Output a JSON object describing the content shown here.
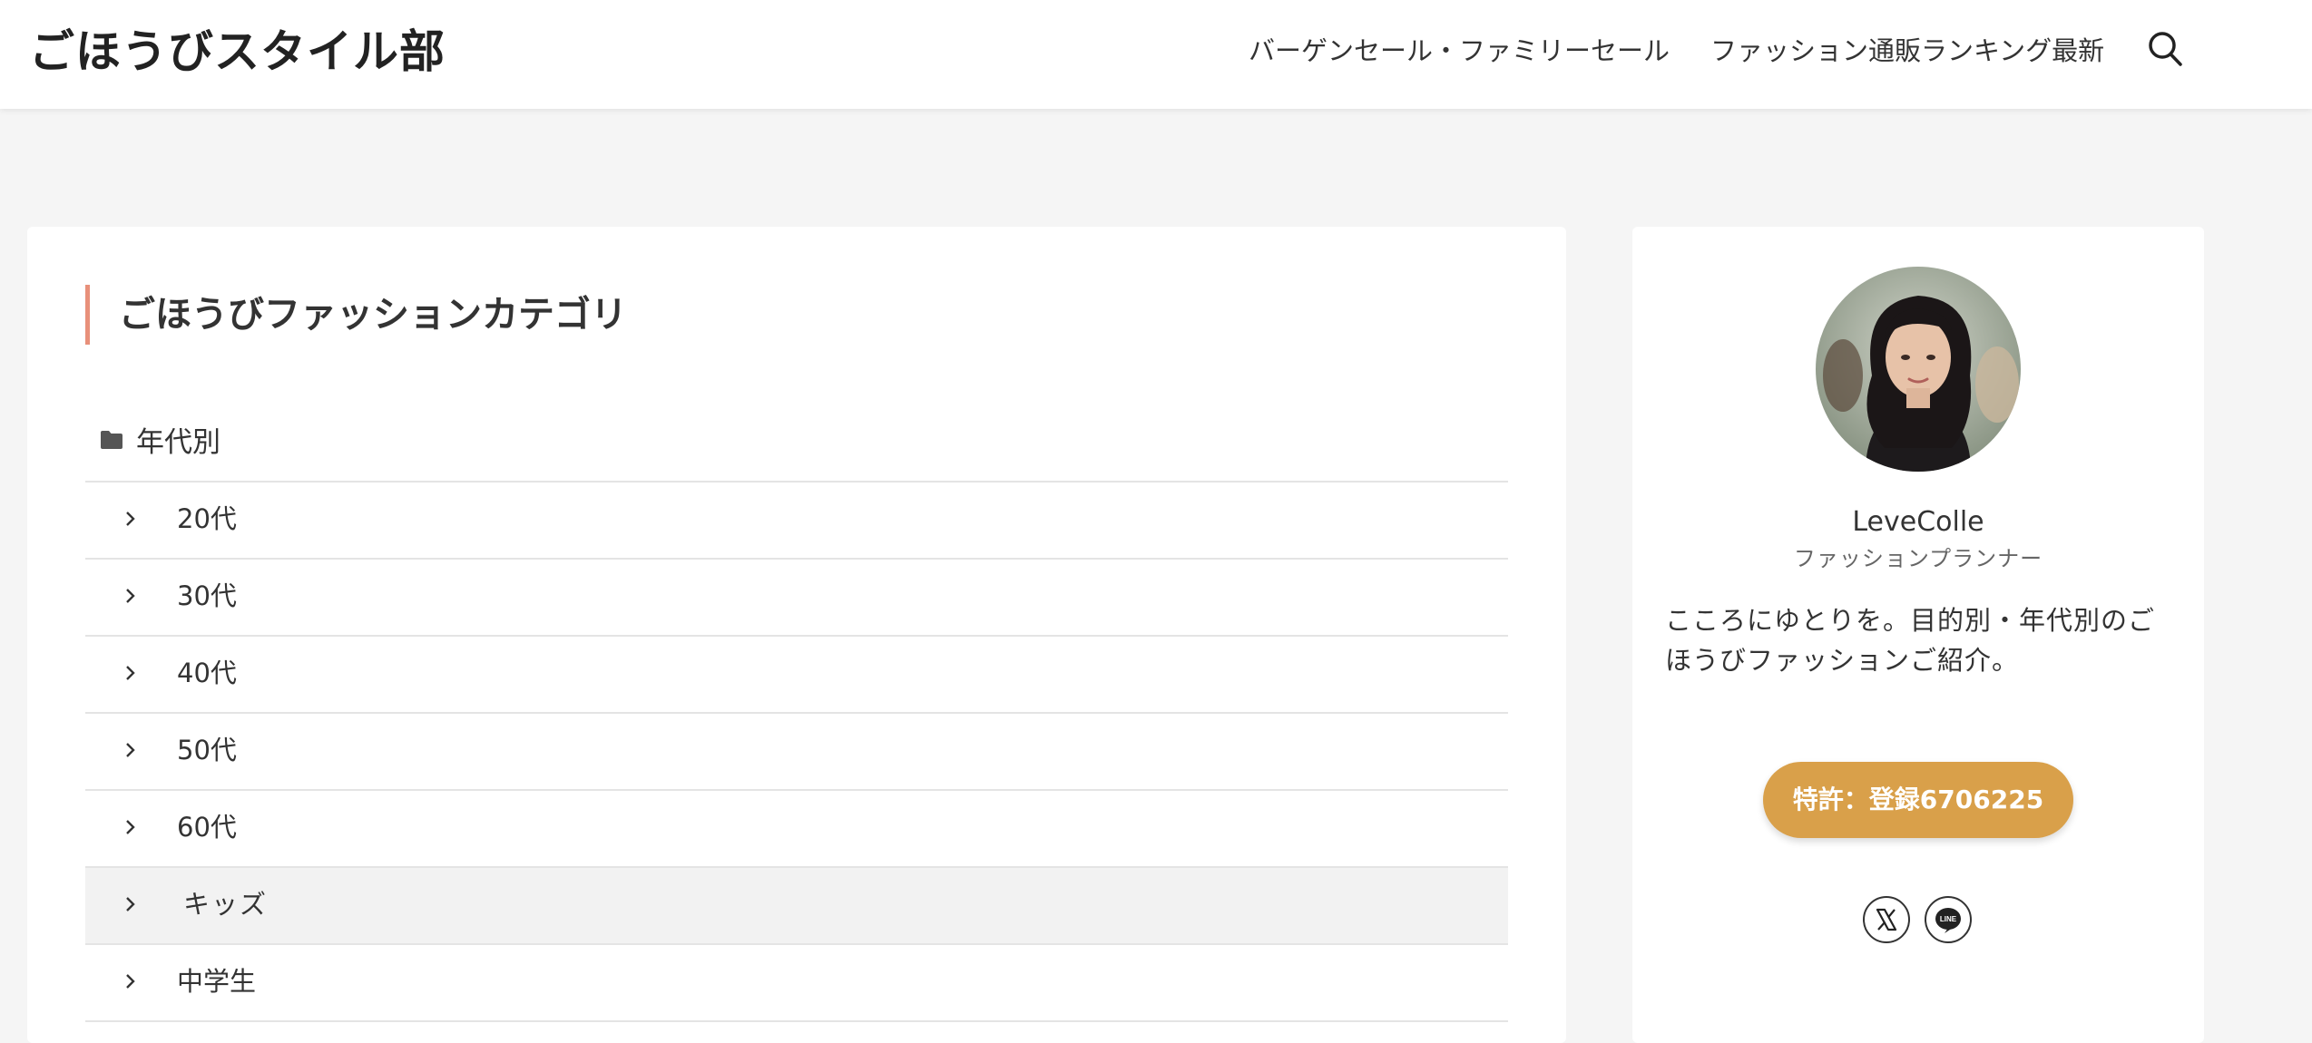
{
  "header": {
    "site_title": "ごほうびスタイル部",
    "nav": [
      {
        "label": "バーゲンセール・ファミリーセール"
      },
      {
        "label": "ファッション通販ランキング最新"
      }
    ],
    "search_icon": "search-icon"
  },
  "main": {
    "section_title": "ごほうびファッションカテゴリ",
    "category_parent": {
      "icon": "folder-icon",
      "label": "年代別"
    },
    "categories": [
      {
        "label": "20代"
      },
      {
        "label": "30代"
      },
      {
        "label": "40代"
      },
      {
        "label": "50代"
      },
      {
        "label": "60代"
      },
      {
        "label": "キッズ"
      },
      {
        "label": "中学生"
      }
    ]
  },
  "profile": {
    "name": "LeveColle",
    "role": "ファッションプランナー",
    "description": "こころにゆとりを。目的別・年代別のごほうびファッションご紹介。",
    "patent_button": "特許：登録6706225",
    "social": [
      {
        "icon": "x-icon"
      },
      {
        "icon": "line-icon"
      }
    ],
    "colors": {
      "accent": "#d9a04a",
      "title_bar": "#e8907a"
    }
  }
}
